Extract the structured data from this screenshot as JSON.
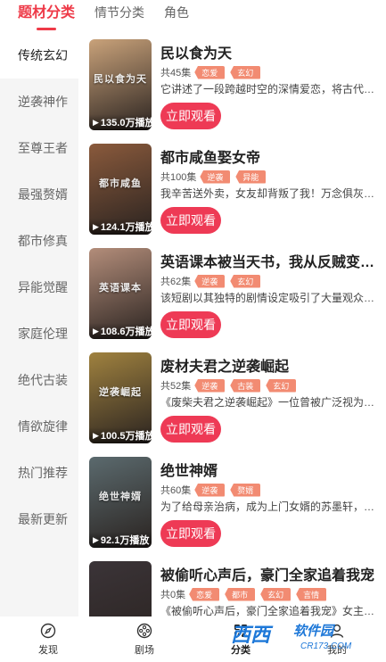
{
  "header": {
    "tabs": [
      {
        "label": "题材分类",
        "active": true
      },
      {
        "label": "情节分类",
        "active": false
      },
      {
        "label": "角色",
        "active": false
      }
    ]
  },
  "sidebar": {
    "items": [
      {
        "label": "传统玄幻",
        "active": true
      },
      {
        "label": "逆袭神作",
        "active": false
      },
      {
        "label": "至尊王者",
        "active": false
      },
      {
        "label": "最强赘婿",
        "active": false
      },
      {
        "label": "都市修真",
        "active": false
      },
      {
        "label": "异能觉醒",
        "active": false
      },
      {
        "label": "家庭伦理",
        "active": false
      },
      {
        "label": "绝代古装",
        "active": false
      },
      {
        "label": "情欲旋律",
        "active": false
      },
      {
        "label": "热门推荐",
        "active": false
      },
      {
        "label": "最新更新",
        "active": false
      }
    ]
  },
  "dramas": [
    {
      "title": "民以食为天",
      "episodes": "共45集",
      "tags": [
        "恋爱",
        "玄幻"
      ],
      "desc": "它讲述了一段跨越时空的深情爱恋，将古代文明与现代生活融为一体",
      "views": "135.0万播放",
      "poster_hint": "民以食为天",
      "color": "#c9a27a",
      "watch_label": "立即观看"
    },
    {
      "title": "都市咸鱼娶女帝",
      "episodes": "共100集",
      "tags": [
        "逆袭",
        "异能"
      ],
      "desc": "我辛苦送外卖，女友却背叛了我！万念俱灰之际",
      "views": "124.1万播放",
      "poster_hint": "都市咸鱼",
      "color": "#8a5a3c",
      "watch_label": "立即观看"
    },
    {
      "title": "英语课本被当天书，我从反贼变成圣人",
      "episodes": "共62集",
      "tags": [
        "逆袭",
        "玄幻"
      ],
      "desc": "该短剧以其独特的剧情设定吸引了大量观众的目光",
      "views": "108.6万播放",
      "poster_hint": "英语课本",
      "color": "#b38d7a",
      "watch_label": "立即观看"
    },
    {
      "title": "废材夫君之逆袭崛起",
      "episodes": "共52集",
      "tags": [
        "逆袭",
        "古装",
        "玄幻"
      ],
      "desc": "《废柴夫君之逆袭崛起》一位曾被广泛视为废材的男子",
      "views": "100.5万播放",
      "poster_hint": "逆袭崛起",
      "color": "#a0823f",
      "watch_label": "立即观看"
    },
    {
      "title": "绝世神婿",
      "episodes": "共60集",
      "tags": [
        "逆袭",
        "赘婿"
      ],
      "desc": "为了给母亲治病，成为上门女婿的苏墨轩，受尽了白眼",
      "views": "92.1万播放",
      "poster_hint": "绝世神婿",
      "color": "#5b6a6e",
      "watch_label": "立即观看"
    },
    {
      "title": "被偷听心声后，豪门全家追着我宠",
      "episodes": "共0集",
      "tags": [
        "恋爱",
        "都市",
        "玄幻",
        "言情"
      ],
      "desc": "《被偷听心声后，豪门全家追着我宠》女主意外穿越",
      "views": "",
      "poster_hint": "",
      "color": "#3b3438",
      "watch_label": "立即观看"
    }
  ],
  "bottom_nav": [
    {
      "label": "发现",
      "icon": "compass-icon",
      "active": false
    },
    {
      "label": "剧场",
      "icon": "film-reel-icon",
      "active": false
    },
    {
      "label": "分类",
      "icon": "category-icon",
      "active": true
    },
    {
      "label": "我的",
      "icon": "user-icon",
      "active": false
    }
  ],
  "watermark": {
    "logo": "西西",
    "sub": "软件园",
    "url": "CR173.COM"
  },
  "colors": {
    "accent": "#ee3a48",
    "button": "#ee3a55",
    "tag": "#f28b72",
    "sidebar_bg": "#f5f5f5"
  }
}
